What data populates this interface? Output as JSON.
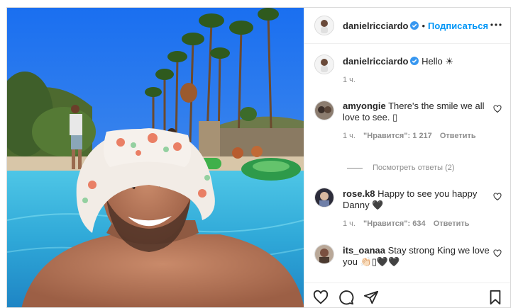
{
  "header": {
    "username": "danielricciardo",
    "dot": "•",
    "follow_label": "Подписаться"
  },
  "caption": {
    "username": "danielricciardo",
    "text": "Hello ☀",
    "time": "1 ч."
  },
  "comments": [
    {
      "username": "amyongie",
      "text_line1": "There's the smile we all",
      "text_line2": "love to see. ▯",
      "time": "1 ч.",
      "likes": "\"Нравится\": 1 217",
      "reply_label": "Ответить"
    },
    {
      "username": "rose.k8",
      "text_line1": "Happy to see you happy",
      "text_line2": "Danny 🖤",
      "time": "1 ч.",
      "likes": "\"Нравится\": 634",
      "reply_label": "Ответить"
    },
    {
      "username": "its_oanaa",
      "text_line1": "Stay strong King we love",
      "text_line2": "you 👏🏻▯🖤🖤"
    }
  ],
  "view_replies": "Посмотреть ответы (2)",
  "actions": {
    "like": "heart-icon",
    "comment": "comment-icon",
    "share": "share-icon",
    "save": "bookmark-icon"
  },
  "colors": {
    "accent": "#0095f6",
    "verified": "#3897f0",
    "muted": "#8e8e8e"
  }
}
